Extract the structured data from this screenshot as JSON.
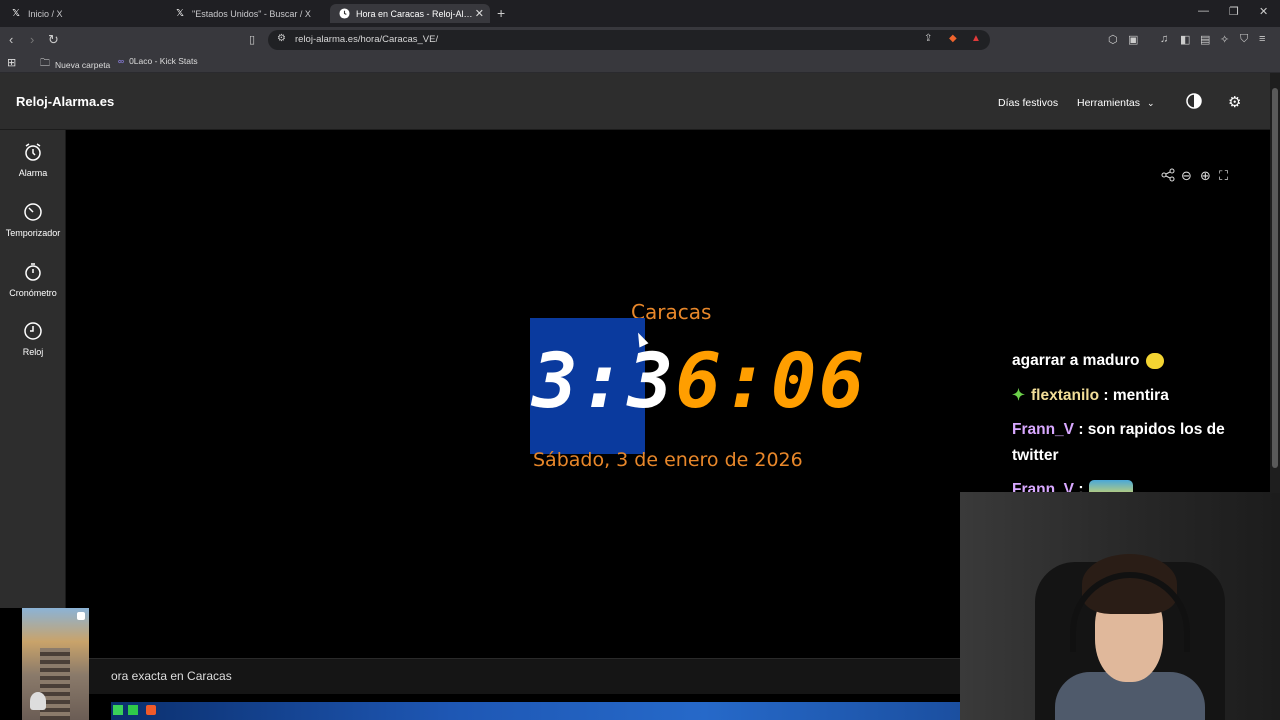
{
  "browser": {
    "tabs": [
      {
        "label": "Inicio / X",
        "icon": "x-logo-icon",
        "active": false
      },
      {
        "label": "\"Estados Unidos\" - Buscar / X",
        "icon": "x-logo-icon",
        "active": false
      },
      {
        "label": "Hora en Caracas - Reloj-Alarma.es",
        "icon": "clock-favicon-icon",
        "active": true
      }
    ],
    "url": "reloj-alarma.es/hora/Caracas_VE/",
    "bookmarks": [
      {
        "label": "Nueva carpeta",
        "icon": "folder-icon"
      },
      {
        "label": "0Laco - Kick Stats",
        "icon": "kick-icon"
      }
    ]
  },
  "site": {
    "logo": "Reloj-Alarma.es",
    "nav": {
      "holidays": "Días festivos",
      "tools": "Herramientas"
    },
    "sidebar": [
      {
        "label": "Alarma",
        "icon": "alarm-clock-icon"
      },
      {
        "label": "Temporizador",
        "icon": "timer-icon"
      },
      {
        "label": "Cronómetro",
        "icon": "stopwatch-icon"
      },
      {
        "label": "Reloj",
        "icon": "clock-icon"
      }
    ],
    "clock": {
      "city": "Caracas",
      "time_selected": "3:3",
      "time_rest": "6:06",
      "date": "Sábado, 3 de enero de 2026"
    },
    "bottom_text": "ora exacta en Caracas"
  },
  "chat": {
    "lines": [
      {
        "user": "",
        "message": "agarrar a maduro"
      },
      {
        "user": "flextanilo",
        "message": "mentira"
      },
      {
        "user": "Frann_V",
        "message": "son rapidos los de twitter"
      },
      {
        "user": "Frann_V",
        "message": ""
      }
    ]
  },
  "colors": {
    "clock_orange": "#ff9e00",
    "selection_blue": "#0a3a9e",
    "header_bg": "#2d2d2d"
  }
}
